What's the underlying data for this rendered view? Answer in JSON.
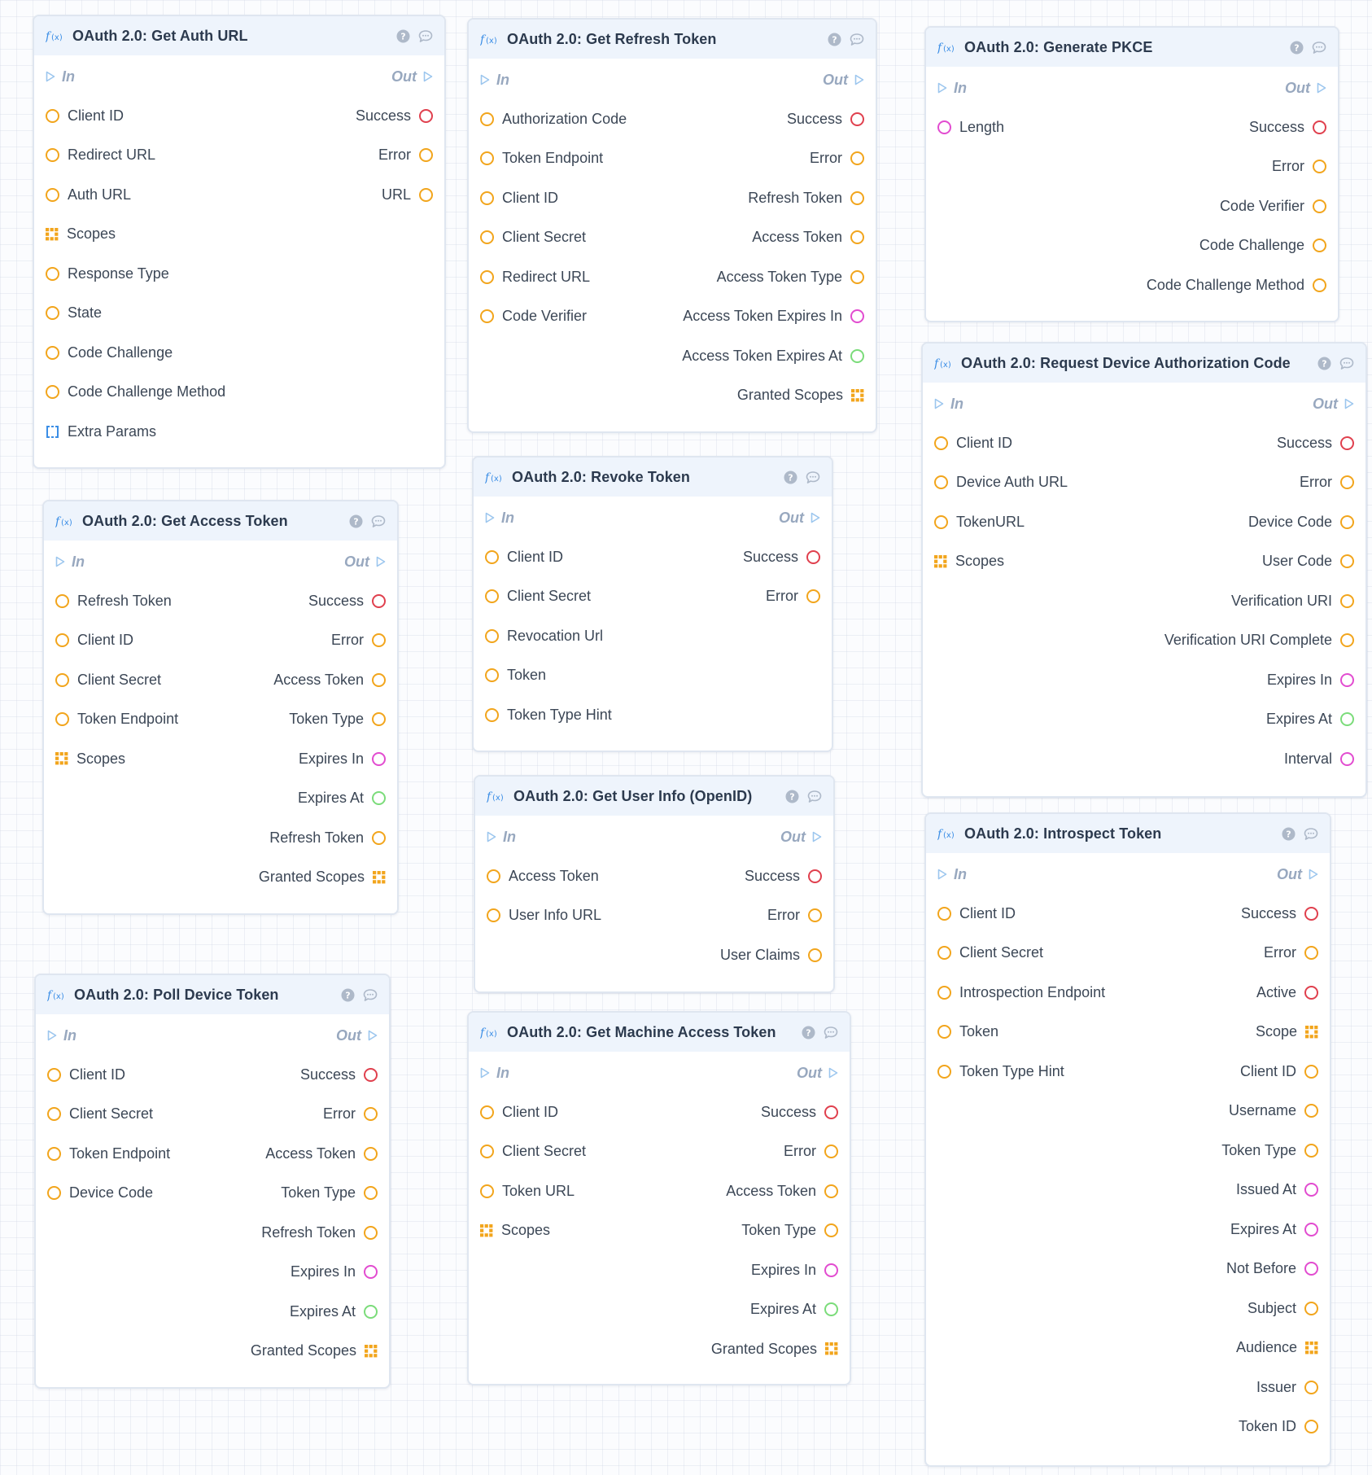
{
  "colors": {
    "orange": "#f2a51c",
    "red": "#e0404e",
    "magenta": "#e24cd0",
    "green": "#7bdc7a",
    "blue": "#3b8ee6",
    "io": "#98a8bf"
  },
  "io_labels": {
    "in": "In",
    "out": "Out"
  },
  "header_icons": [
    "fx-icon",
    "help-icon",
    "comment-icon"
  ],
  "nodes": [
    {
      "id": "get-auth-url",
      "title": "OAuth 2.0: Get Auth URL",
      "inputs": [
        {
          "label": "Client ID",
          "type": "orange"
        },
        {
          "label": "Redirect URL",
          "type": "orange"
        },
        {
          "label": "Auth URL",
          "type": "orange"
        },
        {
          "label": "Scopes",
          "type": "grid"
        },
        {
          "label": "Response Type",
          "type": "orange"
        },
        {
          "label": "State",
          "type": "orange"
        },
        {
          "label": "Code Challenge",
          "type": "orange"
        },
        {
          "label": "Code Challenge Method",
          "type": "orange"
        },
        {
          "label": "Extra Params",
          "type": "bracket"
        }
      ],
      "outputs": [
        {
          "label": "Success",
          "type": "red"
        },
        {
          "label": "Error",
          "type": "orange"
        },
        {
          "label": "URL",
          "type": "orange"
        }
      ]
    },
    {
      "id": "get-refresh-token",
      "title": "OAuth 2.0: Get Refresh Token",
      "inputs": [
        {
          "label": "Authorization Code",
          "type": "orange"
        },
        {
          "label": "Token Endpoint",
          "type": "orange"
        },
        {
          "label": "Client ID",
          "type": "orange"
        },
        {
          "label": "Client Secret",
          "type": "orange"
        },
        {
          "label": "Redirect URL",
          "type": "orange"
        },
        {
          "label": "Code Verifier",
          "type": "orange"
        }
      ],
      "outputs": [
        {
          "label": "Success",
          "type": "red"
        },
        {
          "label": "Error",
          "type": "orange"
        },
        {
          "label": "Refresh Token",
          "type": "orange"
        },
        {
          "label": "Access Token",
          "type": "orange"
        },
        {
          "label": "Access Token Type",
          "type": "orange"
        },
        {
          "label": "Access Token Expires In",
          "type": "magenta"
        },
        {
          "label": "Access Token Expires At",
          "type": "green"
        },
        {
          "label": "Granted Scopes",
          "type": "grid"
        }
      ]
    },
    {
      "id": "generate-pkce",
      "title": "OAuth 2.0: Generate PKCE",
      "inputs": [
        {
          "label": "Length",
          "type": "magenta"
        }
      ],
      "outputs": [
        {
          "label": "Success",
          "type": "red"
        },
        {
          "label": "Error",
          "type": "orange"
        },
        {
          "label": "Code Verifier",
          "type": "orange"
        },
        {
          "label": "Code Challenge",
          "type": "orange"
        },
        {
          "label": "Code Challenge Method",
          "type": "orange"
        }
      ]
    },
    {
      "id": "request-device-authorization-code",
      "title": "OAuth 2.0: Request Device Authorization Code",
      "inputs": [
        {
          "label": "Client ID",
          "type": "orange"
        },
        {
          "label": "Device Auth URL",
          "type": "orange"
        },
        {
          "label": "TokenURL",
          "type": "orange"
        },
        {
          "label": "Scopes",
          "type": "grid"
        }
      ],
      "outputs": [
        {
          "label": "Success",
          "type": "red"
        },
        {
          "label": "Error",
          "type": "orange"
        },
        {
          "label": "Device Code",
          "type": "orange"
        },
        {
          "label": "User Code",
          "type": "orange"
        },
        {
          "label": "Verification URI",
          "type": "orange"
        },
        {
          "label": "Verification URI Complete",
          "type": "orange"
        },
        {
          "label": "Expires In",
          "type": "magenta"
        },
        {
          "label": "Expires At",
          "type": "green"
        },
        {
          "label": "Interval",
          "type": "magenta"
        }
      ]
    },
    {
      "id": "revoke-token",
      "title": "OAuth 2.0: Revoke Token",
      "inputs": [
        {
          "label": "Client ID",
          "type": "orange"
        },
        {
          "label": "Client Secret",
          "type": "orange"
        },
        {
          "label": "Revocation Url",
          "type": "orange"
        },
        {
          "label": "Token",
          "type": "orange"
        },
        {
          "label": "Token Type Hint",
          "type": "orange"
        }
      ],
      "outputs": [
        {
          "label": "Success",
          "type": "red"
        },
        {
          "label": "Error",
          "type": "orange"
        }
      ]
    },
    {
      "id": "get-access-token",
      "title": "OAuth 2.0: Get Access Token",
      "inputs": [
        {
          "label": "Refresh Token",
          "type": "orange"
        },
        {
          "label": "Client ID",
          "type": "orange"
        },
        {
          "label": "Client Secret",
          "type": "orange"
        },
        {
          "label": "Token Endpoint",
          "type": "orange"
        },
        {
          "label": "Scopes",
          "type": "grid"
        }
      ],
      "outputs": [
        {
          "label": "Success",
          "type": "red"
        },
        {
          "label": "Error",
          "type": "orange"
        },
        {
          "label": "Access Token",
          "type": "orange"
        },
        {
          "label": "Token Type",
          "type": "orange"
        },
        {
          "label": "Expires In",
          "type": "magenta"
        },
        {
          "label": "Expires At",
          "type": "green"
        },
        {
          "label": "Refresh Token",
          "type": "orange"
        },
        {
          "label": "Granted Scopes",
          "type": "grid"
        }
      ]
    },
    {
      "id": "get-user-info",
      "title": "OAuth 2.0: Get User Info (OpenID)",
      "inputs": [
        {
          "label": "Access Token",
          "type": "orange"
        },
        {
          "label": "User Info URL",
          "type": "orange"
        }
      ],
      "outputs": [
        {
          "label": "Success",
          "type": "red"
        },
        {
          "label": "Error",
          "type": "orange"
        },
        {
          "label": "User Claims",
          "type": "orange"
        }
      ]
    },
    {
      "id": "introspect-token",
      "title": "OAuth 2.0: Introspect Token",
      "inputs": [
        {
          "label": "Client ID",
          "type": "orange"
        },
        {
          "label": "Client Secret",
          "type": "orange"
        },
        {
          "label": "Introspection Endpoint",
          "type": "orange"
        },
        {
          "label": "Token",
          "type": "orange"
        },
        {
          "label": "Token Type Hint",
          "type": "orange"
        }
      ],
      "outputs": [
        {
          "label": "Success",
          "type": "red"
        },
        {
          "label": "Error",
          "type": "orange"
        },
        {
          "label": "Active",
          "type": "red"
        },
        {
          "label": "Scope",
          "type": "grid"
        },
        {
          "label": "Client ID",
          "type": "orange"
        },
        {
          "label": "Username",
          "type": "orange"
        },
        {
          "label": "Token Type",
          "type": "orange"
        },
        {
          "label": "Issued At",
          "type": "magenta"
        },
        {
          "label": "Expires At",
          "type": "magenta"
        },
        {
          "label": "Not Before",
          "type": "magenta"
        },
        {
          "label": "Subject",
          "type": "orange"
        },
        {
          "label": "Audience",
          "type": "grid"
        },
        {
          "label": "Issuer",
          "type": "orange"
        },
        {
          "label": "Token ID",
          "type": "orange"
        }
      ]
    },
    {
      "id": "poll-device-token",
      "title": "OAuth 2.0: Poll Device Token",
      "inputs": [
        {
          "label": "Client ID",
          "type": "orange"
        },
        {
          "label": "Client Secret",
          "type": "orange"
        },
        {
          "label": "Token Endpoint",
          "type": "orange"
        },
        {
          "label": "Device Code",
          "type": "orange"
        }
      ],
      "outputs": [
        {
          "label": "Success",
          "type": "red"
        },
        {
          "label": "Error",
          "type": "orange"
        },
        {
          "label": "Access Token",
          "type": "orange"
        },
        {
          "label": "Token Type",
          "type": "orange"
        },
        {
          "label": "Refresh Token",
          "type": "orange"
        },
        {
          "label": "Expires In",
          "type": "magenta"
        },
        {
          "label": "Expires At",
          "type": "green"
        },
        {
          "label": "Granted Scopes",
          "type": "grid"
        }
      ]
    },
    {
      "id": "get-machine-access-token",
      "title": "OAuth 2.0: Get Machine Access Token",
      "inputs": [
        {
          "label": "Client ID",
          "type": "orange"
        },
        {
          "label": "Client Secret",
          "type": "orange"
        },
        {
          "label": "Token URL",
          "type": "orange"
        },
        {
          "label": "Scopes",
          "type": "grid"
        }
      ],
      "outputs": [
        {
          "label": "Success",
          "type": "red"
        },
        {
          "label": "Error",
          "type": "orange"
        },
        {
          "label": "Access Token",
          "type": "orange"
        },
        {
          "label": "Token Type",
          "type": "orange"
        },
        {
          "label": "Expires In",
          "type": "magenta"
        },
        {
          "label": "Expires At",
          "type": "green"
        },
        {
          "label": "Granted Scopes",
          "type": "grid"
        }
      ]
    }
  ]
}
